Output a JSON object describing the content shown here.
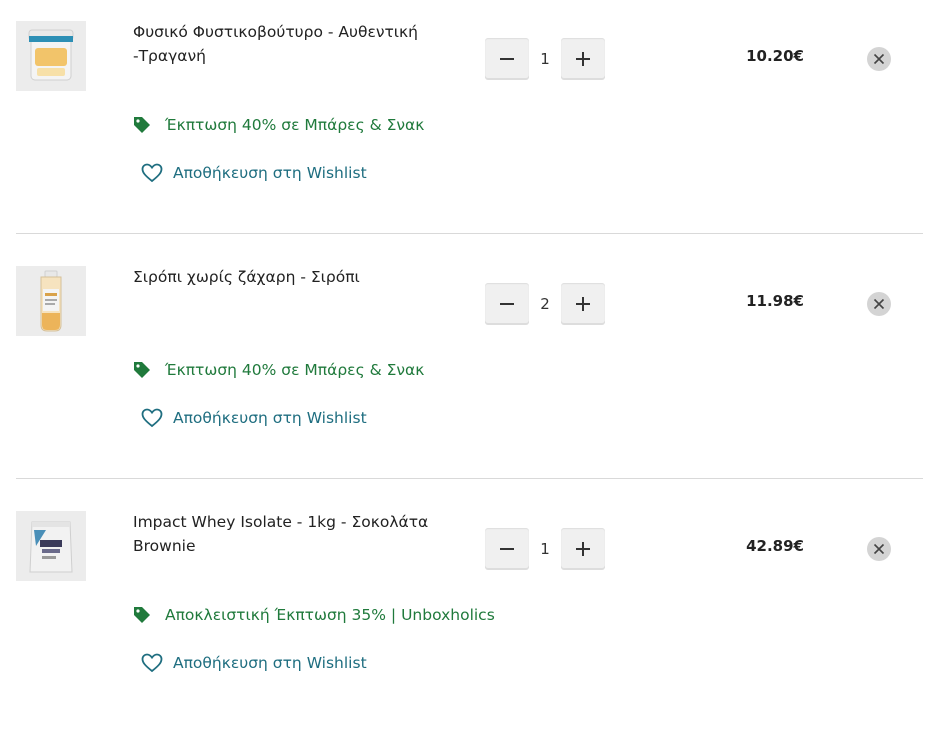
{
  "cart": {
    "items": [
      {
        "name": "Φυσικό Φυστικοβούτυρο - Αυθεντική -Τραγανή",
        "quantity": "1",
        "price": "10.20€",
        "promo": "Έκπτωση 40% σε Μπάρες & Σνακ",
        "wishlist_label": "Αποθήκευση στη Wishlist",
        "thumbnail": "peanut-butter-tub"
      },
      {
        "name": "Σιρόπι χωρίς ζάχαρη - Σιρόπι",
        "quantity": "2",
        "price": "11.98€",
        "promo": "Έκπτωση 40% σε Μπάρες & Σνακ",
        "wishlist_label": "Αποθήκευση στη Wishlist",
        "thumbnail": "syrup-bottle"
      },
      {
        "name": "Impact Whey Isolate - 1kg - Σοκολάτα Brownie",
        "quantity": "1",
        "price": "42.89€",
        "promo": "Αποκλειστική Έκπτωση 35% | Unboxholics",
        "wishlist_label": "Αποθήκευση στη Wishlist",
        "thumbnail": "whey-pouch"
      }
    ]
  },
  "colors": {
    "promo_green": "#207a3c",
    "wishlist_teal": "#1f6e80",
    "qty_button_bg": "#f0f0f0",
    "remove_button_bg": "#d4d4d4"
  },
  "icons": {
    "promo": "tag-icon",
    "wishlist": "heart-outline-icon",
    "decrease": "minus-icon",
    "increase": "plus-icon",
    "remove": "close-icon"
  }
}
